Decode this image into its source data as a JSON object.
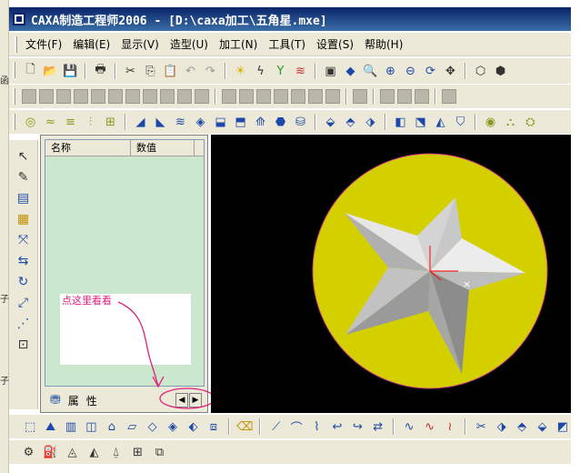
{
  "window": {
    "title": "CAXA制造工程师2006  - [D:\\caxa加工\\五角星.mxe]"
  },
  "left_strip_chars": [
    "函",
    "子",
    "子"
  ],
  "menu": [
    {
      "label": "文件(F)"
    },
    {
      "label": "编辑(E)"
    },
    {
      "label": "显示(V)"
    },
    {
      "label": "造型(U)"
    },
    {
      "label": "加工(N)"
    },
    {
      "label": "工具(T)"
    },
    {
      "label": "设置(S)"
    },
    {
      "label": "帮助(H)"
    }
  ],
  "standard_toolbar": {
    "icons": [
      "new-file-icon",
      "open-folder-icon",
      "save-icon",
      "print-icon",
      "cut-icon",
      "copy-icon",
      "paste-icon",
      "undo-icon",
      "redo-icon",
      "light-icon",
      "regen-icon",
      "filter-icon",
      "layer-icon",
      "panel-toggle-icon",
      "shading-icon",
      "zoom-window-icon",
      "zoom-in-icon",
      "zoom-dynamic-icon",
      "rotate-icon",
      "pan-icon",
      "wireframe-icon",
      "shaded-icon"
    ]
  },
  "tree_panel": {
    "columns": [
      "名称",
      "数值"
    ],
    "tabs": [
      "属",
      "性"
    ]
  },
  "annotation": {
    "text": "点这里看看",
    "color": "#e0207a"
  },
  "colors": {
    "panel_bg": "#cbe8cf",
    "viewport_bg": "#000000",
    "disk_fill": "#d4d000",
    "star_light": "#e0e0e0",
    "star_mid": "#b4b4b4",
    "star_dark": "#8c8c8c",
    "axis_red": "#ff0000"
  }
}
